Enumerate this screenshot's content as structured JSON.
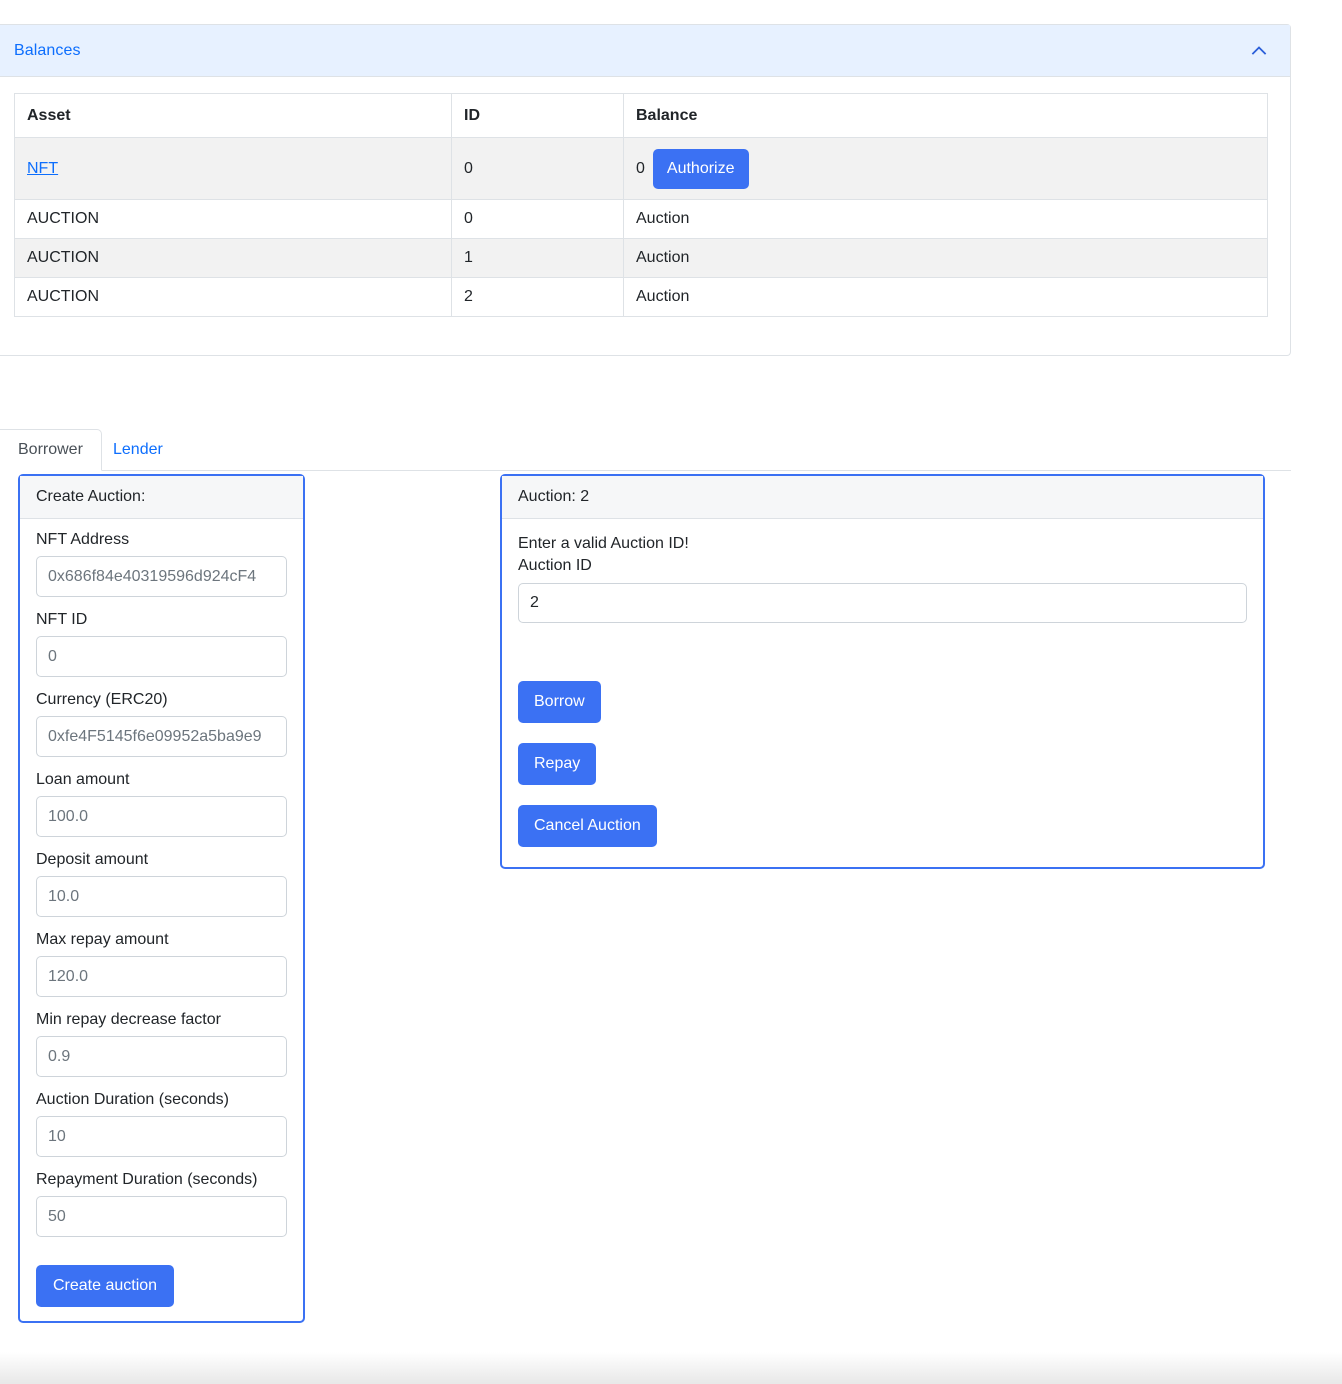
{
  "balances": {
    "title": "Balances",
    "collapse_icon": "chevron-up-icon",
    "table": {
      "headers": [
        "Asset",
        "ID",
        "Balance"
      ],
      "rows": [
        {
          "asset": "NFT",
          "asset_is_link": true,
          "id": "0",
          "balance": "0",
          "action_label": "Authorize"
        },
        {
          "asset": "AUCTION",
          "asset_is_link": false,
          "id": "0",
          "balance": "Auction",
          "action_label": ""
        },
        {
          "asset": "AUCTION",
          "asset_is_link": false,
          "id": "1",
          "balance": "Auction",
          "action_label": ""
        },
        {
          "asset": "AUCTION",
          "asset_is_link": false,
          "id": "2",
          "balance": "Auction",
          "action_label": ""
        }
      ]
    }
  },
  "tabs": [
    {
      "label": "Borrower",
      "active": true
    },
    {
      "label": "Lender",
      "active": false
    }
  ],
  "create_auction": {
    "header": "Create Auction:",
    "fields": [
      {
        "label": "NFT Address",
        "placeholder": "0x686f84e40319596d924cF4",
        "value": ""
      },
      {
        "label": "NFT ID",
        "placeholder": "0",
        "value": ""
      },
      {
        "label": "Currency (ERC20)",
        "placeholder": "0xfe4F5145f6e09952a5ba9e9",
        "value": ""
      },
      {
        "label": "Loan amount",
        "placeholder": "100.0",
        "value": ""
      },
      {
        "label": "Deposit amount",
        "placeholder": "10.0",
        "value": ""
      },
      {
        "label": "Max repay amount",
        "placeholder": "120.0",
        "value": ""
      },
      {
        "label": "Min repay decrease factor",
        "placeholder": "0.9",
        "value": ""
      },
      {
        "label": "Auction Duration (seconds)",
        "placeholder": "10",
        "value": ""
      },
      {
        "label": "Repayment Duration (seconds)",
        "placeholder": "50",
        "value": ""
      }
    ],
    "submit_label": "Create auction"
  },
  "auction_panel": {
    "header": "Auction: 2",
    "notice": "Enter a valid Auction ID!",
    "auction_id_label": "Auction ID",
    "auction_id_value": "2",
    "auction_id_placeholder": "",
    "buttons": [
      {
        "label": "Borrow"
      },
      {
        "label": "Repay"
      },
      {
        "label": "Cancel Auction"
      }
    ]
  },
  "colors": {
    "accent": "#3b71f3",
    "link": "#0d6efd",
    "header_bg": "#e7f1ff",
    "panel_header_bg": "#f6f7f8",
    "border": "#dee2e6",
    "stripe": "#f2f2f2"
  }
}
